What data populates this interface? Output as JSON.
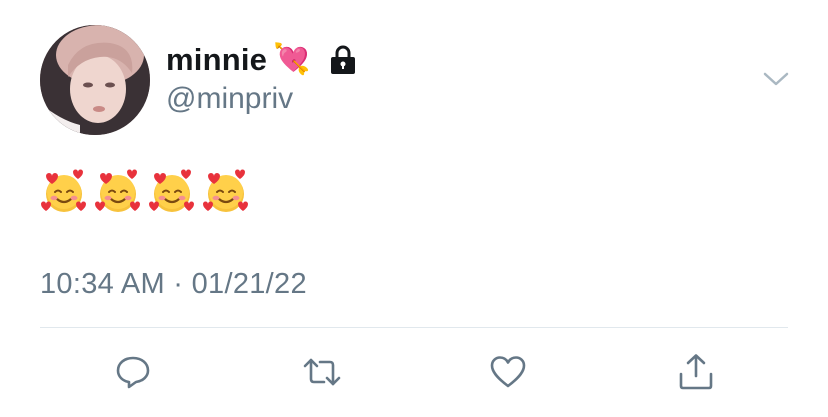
{
  "user": {
    "display_name": "minnie",
    "name_emoji": "💘",
    "handle": "@minpriv",
    "protected_icon": "lock-icon"
  },
  "tweet": {
    "emojis": [
      "🥰",
      "🥰",
      "🥰",
      "🥰"
    ],
    "timestamp": "10:34 AM · 01/21/22"
  },
  "actions": {
    "reply_icon": "reply-icon",
    "retweet_icon": "retweet-icon",
    "like_icon": "heart-icon",
    "share_icon": "share-icon"
  },
  "colors": {
    "name": "#14171a",
    "secondary": "#657786",
    "divider": "#e1e8ed"
  }
}
